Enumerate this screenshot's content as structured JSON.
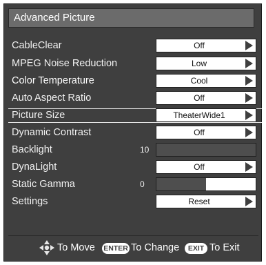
{
  "title": "Advanced Picture",
  "items": [
    {
      "label": "CableClear",
      "value": "Off",
      "type": "select"
    },
    {
      "label": "MPEG Noise Reduction",
      "value": "Low",
      "type": "select"
    },
    {
      "label": "Color Temperature",
      "value": "Cool",
      "type": "select"
    },
    {
      "label": "Auto Aspect Ratio",
      "value": "Off",
      "type": "select"
    },
    {
      "label": "Picture Size",
      "value": "TheaterWide1",
      "type": "select",
      "selected": true
    },
    {
      "label": "Dynamic Contrast",
      "value": "Off",
      "type": "select"
    },
    {
      "label": "Backlight",
      "number": "10",
      "level": 1.0,
      "type": "slider"
    },
    {
      "label": "DynaLight",
      "value": "Off",
      "type": "select"
    },
    {
      "label": "Static Gamma",
      "number": "0",
      "level": 0.5,
      "type": "slider"
    },
    {
      "label": "Settings",
      "value": "Reset",
      "type": "select"
    }
  ],
  "footer": {
    "move_icon": "dpad-icon",
    "move_text": "To Move",
    "enter_key": "ENTER",
    "enter_text": "To Change",
    "exit_key": "EXIT",
    "exit_text": "To Exit"
  },
  "colors": {
    "panel": "#3f3f3f",
    "title_bar": "#6b6b6b",
    "value_box": "#ffffff",
    "slider_fill": "#4e4e4e"
  }
}
